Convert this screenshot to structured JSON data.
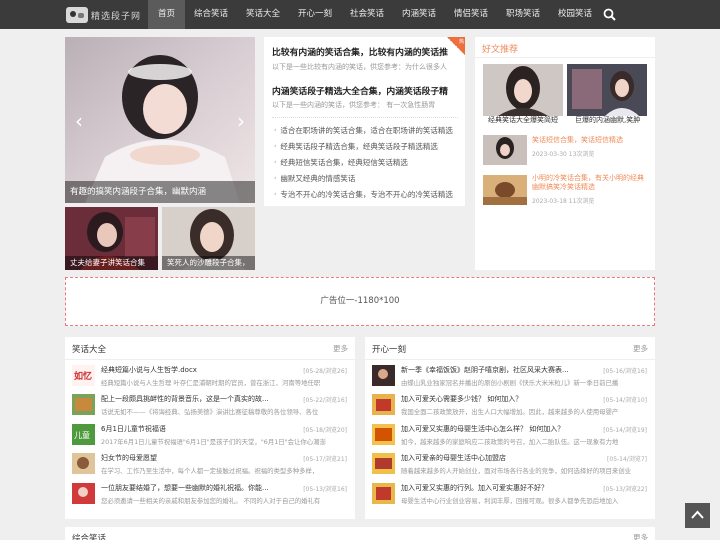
{
  "nav": {
    "logo_text": "精选段子网",
    "items": [
      "首页",
      "综合笑话",
      "笑话大全",
      "开心一刻",
      "社会笑话",
      "内涵笑话",
      "情侣笑话",
      "职场笑话",
      "校园笑话"
    ],
    "active_index": 0
  },
  "slider": {
    "caption": "有趣的搞笑内涵段子合集，幽默内涵",
    "prev": "‹",
    "next": "›",
    "thumbs": [
      "丈夫给妻子讲笑话合集",
      "笑死人的沙雕段子合集，"
    ]
  },
  "hot": {
    "badge": "热",
    "items": [
      {
        "title": "比较有内涵的笑话合集，比较有内涵的笑话推",
        "desc": "以下是一些比较有内涵的笑话，供您参考：为什么很多人"
      },
      {
        "title": "内涵笑话段子精选大全合集，内涵笑话段子精",
        "desc": "以下是一些内涵的笑话，供您参考：  有一次急性肠胃"
      }
    ],
    "bullets": [
      "适合在职场讲的笑话合集，适合在职场讲的笑话精选",
      "经典笑话段子精选合集，经典笑话段子精选精选",
      "经典短信笑话合集，经典短信笑话精选",
      "幽默又经典的情感笑话",
      "专治不开心的冷笑话合集，专治不开心的冷笑话精选"
    ]
  },
  "recommend": {
    "title": "好文推荐",
    "top": [
      {
        "caption": "经典笑话大全爆笑简短"
      },
      {
        "caption": "巨爆的内涵幽默,笑肿"
      }
    ],
    "list": [
      {
        "title": "笑话短信合集，笑话短信精选",
        "date": "2023-03-30",
        "views": "13次浏览"
      },
      {
        "title": "小明的冷笑话合集，有关小明的经典幽默搞笑冷笑话精选",
        "date": "2023-03-18",
        "views": "11次浏览"
      }
    ]
  },
  "ad": {
    "text": "广告位一-1180*100"
  },
  "jokes": {
    "title": "笑话大全",
    "more": "更多",
    "rows": [
      {
        "title": "经典短篇小说与人生哲学.docx",
        "date": "[05-28/浏览26]",
        "snippet": "经典短篇小说与人生哲理 叶存仁是浦朝时期的官员，曾在浙江、河南等地任职"
      },
      {
        "title": "配上一段颇具挑衅性的背景音乐，这是一个真实的故...",
        "date": "[05-22/浏览16]",
        "snippet": "话说无如不——《将诲经典、弘扬美德》演讲比赛征稿尊敬的各位领导、各位"
      },
      {
        "title": "6月1日儿童节祝福语",
        "date": "[05-18/浏览20]",
        "snippet": "2017年6月1日儿童节祝福语\"6月1日\"是孩子们的天堂，\"6月1日\"会让你心潮澎"
      },
      {
        "title": "妇女节的母爱愿望",
        "date": "[05-17/浏览21]",
        "snippet": "在学习、工作乃至生活中，每个人都一定接触过祝福。祝福的类型多种多样，"
      },
      {
        "title": "一位朋友要结婚了，想要一些幽默的婚礼祝福。你能...",
        "date": "[05-13/浏览16]",
        "snippet": "您必须邀请一些相关的亲戚和朋友参加您的婚礼。 不同的人对于自己的婚礼有"
      }
    ]
  },
  "happy": {
    "title": "开心一刻",
    "more": "更多",
    "rows": [
      {
        "title": "新一季《幸福饭饭》赵阴子嘻京剧，社区风采大赛表...",
        "date": "[05-16/浏览16]",
        "snippet": "由蝶山乳业独家冠名并播出的原创小剧剧《快乐大米米粒儿》新一季日前已播"
      },
      {
        "title": "加入可爱关心需要多少钱？ 如何加入？",
        "date": "[05-14/浏览10]",
        "snippet": "我国全面二孩政策放开，出生人口大幅增加。因此，越来越多的人使用母婴产"
      },
      {
        "title": "加入可爱又实惠的母婴生活中心怎么样？ 如何加入？",
        "date": "[05-14/浏览19]",
        "snippet": "如今，越来越多的家庭响应二孩政策的号召，加入二胎队伍。这一现象有力地"
      },
      {
        "title": "加入可爱亲的母婴生活中心加盟店",
        "date": "[05-14/浏览7]",
        "snippet": "随着越来越多的人开始创业，面对市场各行各业的竞争，如何选择好的项目来创业"
      },
      {
        "title": "加入可爱又实惠的行列。加入可爱实惠好不好？",
        "date": "[05-13/浏览22]",
        "snippet": "母婴生活中心行业创业容易，利润丰厚，回报可观。很多人都争先恐后地加入"
      }
    ]
  },
  "bottom": {
    "title": "综合笑话",
    "more": "更多"
  },
  "totop": "^"
}
